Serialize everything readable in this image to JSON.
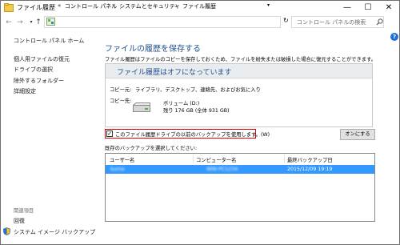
{
  "window": {
    "title": "ファイル履歴",
    "minimize": "—",
    "maximize": "☐",
    "close": "✕"
  },
  "address": {
    "back": "←",
    "forward": "→",
    "up": "↑",
    "parts": [
      "コントロール パネル",
      "システムとセキュリティ",
      "ファイル履歴"
    ],
    "separator": "›",
    "lead": "«",
    "refresh": "↻",
    "search_placeholder": "コントロール パネルの検索"
  },
  "sidebar": {
    "home": "コントロール パネル ホーム",
    "items": [
      "個人用ファイルの復元",
      "ドライブの選択",
      "除外するフォルダー",
      "詳細設定"
    ],
    "related_title": "関連項目",
    "related": [
      "回復",
      "システム イメージ バックアップ"
    ]
  },
  "main": {
    "title": "ファイルの履歴を保存する",
    "description": "ファイル履歴はファイルのコピーを保存しておくため、ファイルを紛失または破損した場合に復元することができます。",
    "status": "ファイル履歴はオフになっています",
    "copy_from_label": "コピー元:",
    "copy_from_value": "ライブラリ、デスクトップ、連絡先、およびお気に入り",
    "copy_to_label": "コピー先:",
    "drive_name": "ボリューム (D:)",
    "drive_space": "残り 176 GB (全体 931 GB)",
    "checkbox_label": "このファイル履歴ドライブの以前のバックアップを使用します。(W)",
    "checkbox_checked": true,
    "turn_on_button": "オンにする",
    "list_caption": "既存のバックアップを選択してください:",
    "columns": [
      "ユーザー名",
      "コンピューター名",
      "最終バックアップ日"
    ],
    "rows": [
      {
        "user": "kuma",
        "computer": "WIN-PC1234",
        "date": "2015/12/09 19:19"
      }
    ]
  },
  "colors": {
    "accent_title": "#1e4e8c",
    "selection": "#3399ff",
    "highlight_border": "#e00000"
  },
  "icons": {
    "help": "question-icon",
    "drive": "hard-drive-icon",
    "shield": "shield-icon"
  }
}
